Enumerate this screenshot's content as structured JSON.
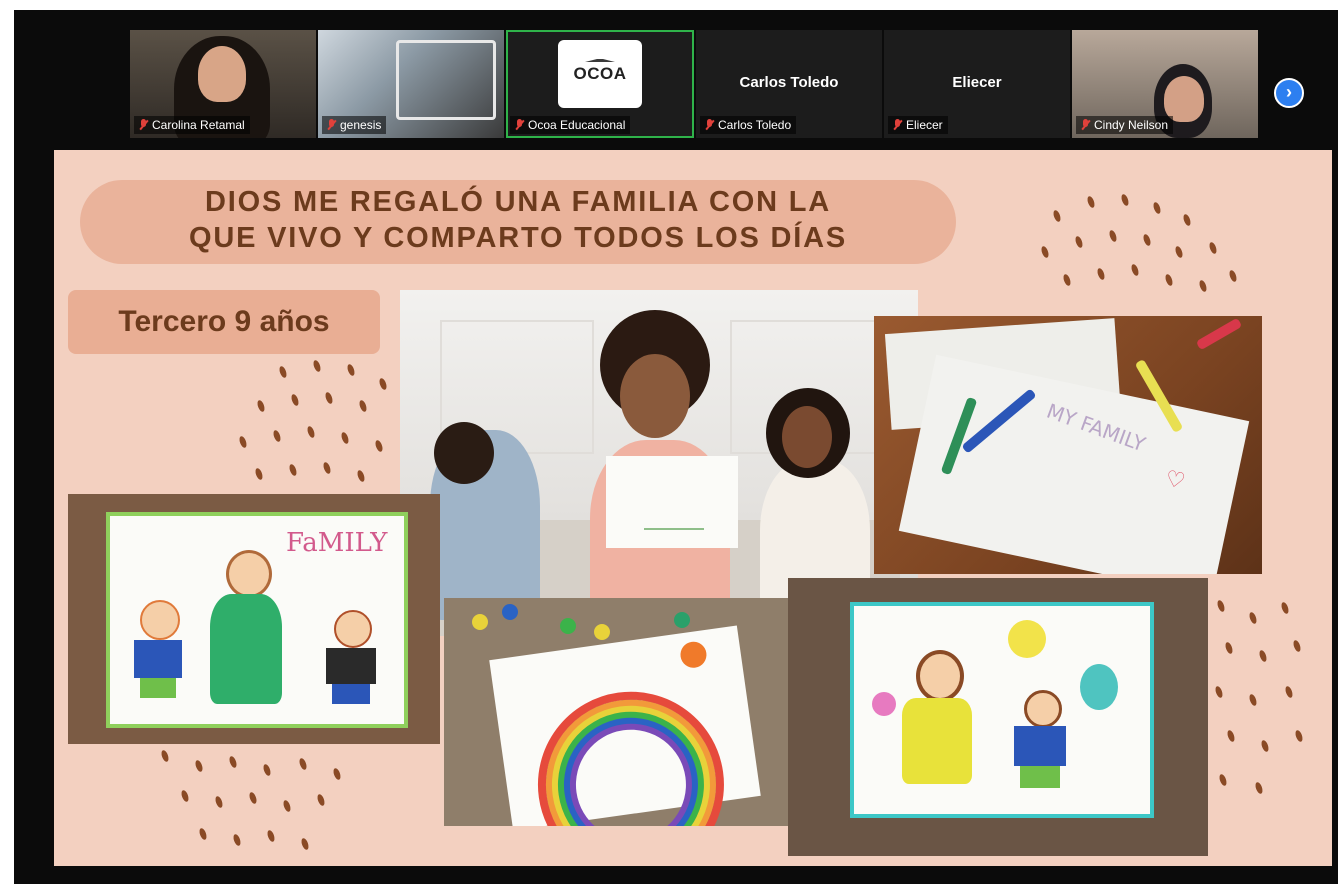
{
  "participants": [
    {
      "name": "Carolina Retamal",
      "video": true
    },
    {
      "name": "genesis",
      "video": true
    },
    {
      "name": "Ocoa Educacional",
      "video": false,
      "active": true
    },
    {
      "name": "Carlos Toledo",
      "video": false,
      "display_name": "Carlos Toledo"
    },
    {
      "name": "Eliecer",
      "video": false,
      "display_name": "Eliecer"
    },
    {
      "name": "Cindy Neilson",
      "video": true
    }
  ],
  "ocoa_logo_text": "OCOA",
  "next_icon": "chevron-right-icon",
  "slide": {
    "title_line1": "DIOS ME REGALÓ UNA FAMILIA CON LA",
    "title_line2": "QUE VIVO Y COMPARTO TODOS LOS DÍAS",
    "grade_label": "Tercero 9 años",
    "family_word": "FaMILY",
    "my_family_word": "MY FAMILY"
  },
  "colors": {
    "slide_bg": "#f3d0c0",
    "title_pill": "#eab39b",
    "title_text": "#6c3b1d",
    "muted_icon": "#e0413b",
    "active_border": "#2fb34a",
    "next_button": "#2d7ff0"
  }
}
